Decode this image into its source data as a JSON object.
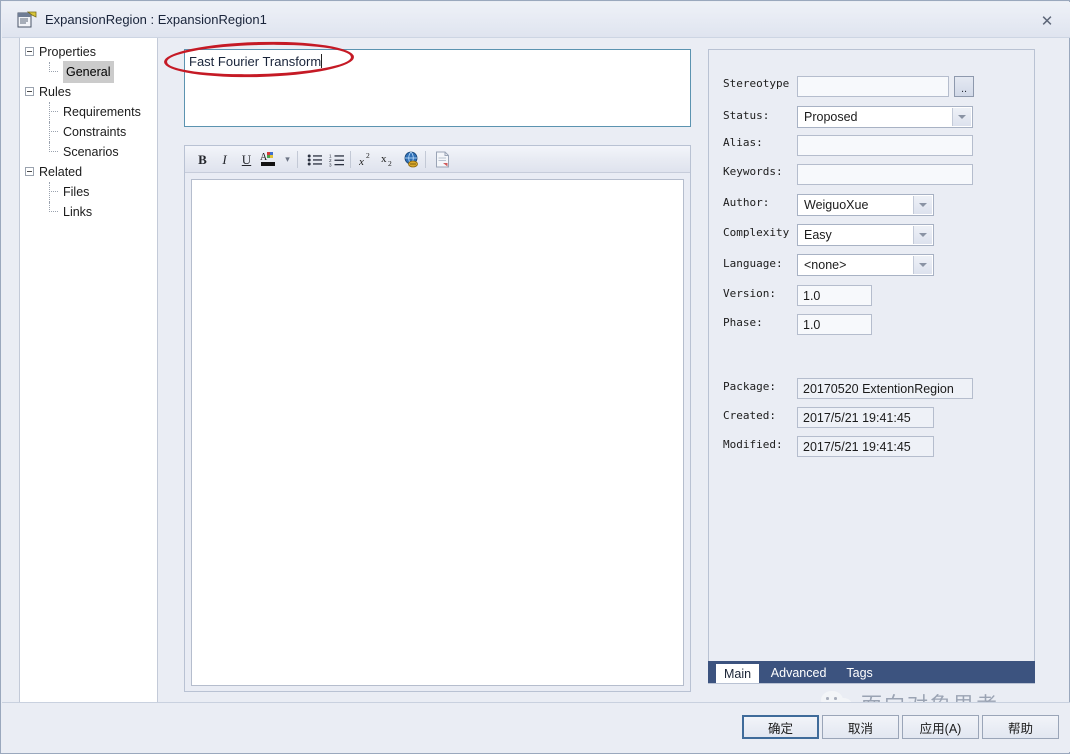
{
  "window": {
    "title": "ExpansionRegion : ExpansionRegion1",
    "icon": "properties-document-icon",
    "close_label": "✕"
  },
  "tree": {
    "nodes": [
      {
        "label": "Properties",
        "level": 0,
        "expanded": true,
        "selected": false
      },
      {
        "label": "General",
        "level": 1,
        "expanded": false,
        "selected": true
      },
      {
        "label": "Rules",
        "level": 0,
        "expanded": true,
        "selected": false
      },
      {
        "label": "Requirements",
        "level": 1,
        "expanded": false,
        "selected": false
      },
      {
        "label": "Constraints",
        "level": 1,
        "expanded": false,
        "selected": false
      },
      {
        "label": "Scenarios",
        "level": 1,
        "expanded": false,
        "selected": false
      },
      {
        "label": "Related",
        "level": 0,
        "expanded": true,
        "selected": false
      },
      {
        "label": "Files",
        "level": 1,
        "expanded": false,
        "selected": false
      },
      {
        "label": "Links",
        "level": 1,
        "expanded": false,
        "selected": false
      }
    ]
  },
  "name_field": {
    "value": "Fast Fourier Transform",
    "placeholder": "",
    "highlight_color": "#c51a25",
    "border_color": "#5b93b0"
  },
  "notes": {
    "value": "",
    "placeholder": "",
    "toolbar": [
      {
        "name": "bold-icon",
        "glyph": "B"
      },
      {
        "name": "italic-icon",
        "glyph": "I"
      },
      {
        "name": "underline-icon",
        "glyph": "U"
      },
      {
        "name": "font-color-icon",
        "glyph": "A"
      },
      {
        "name": "chevron-down-icon",
        "glyph": "▾"
      },
      {
        "name": "bulleted-list-icon",
        "glyph": "•≡"
      },
      {
        "name": "numbered-list-icon",
        "glyph": "1≡"
      },
      {
        "name": "superscript-icon",
        "glyph": "x²"
      },
      {
        "name": "subscript-icon",
        "glyph": "x₂"
      },
      {
        "name": "hyperlink-globe-icon",
        "glyph": "ἱ0"
      },
      {
        "name": "insert-document-icon",
        "glyph": "὜b"
      }
    ]
  },
  "properties": {
    "fields": [
      {
        "name": "stereotype",
        "label": "Stereotype",
        "value": "",
        "kind": "text-with-browse",
        "browse_label": ".."
      },
      {
        "name": "status",
        "label": "Status:",
        "value": "Proposed",
        "kind": "combo"
      },
      {
        "name": "alias",
        "label": "Alias:",
        "value": "",
        "kind": "text"
      },
      {
        "name": "keywords",
        "label": "Keywords:",
        "value": "",
        "kind": "text"
      },
      {
        "name": "author",
        "label": "Author:",
        "value": "WeiguoXue",
        "kind": "combo"
      },
      {
        "name": "complexity",
        "label": "Complexity",
        "value": "Easy",
        "kind": "combo"
      },
      {
        "name": "language",
        "label": "Language:",
        "value": "<none>",
        "kind": "combo"
      },
      {
        "name": "version",
        "label": "Version:",
        "value": "1.0",
        "kind": "text-small"
      },
      {
        "name": "phase",
        "label": "Phase:",
        "value": "1.0",
        "kind": "text-small"
      },
      {
        "name": "package",
        "label": "Package:",
        "value": "20170520 ExtentionRegion",
        "kind": "readonly"
      },
      {
        "name": "created",
        "label": "Created:",
        "value": "2017/5/21 19:41:45",
        "kind": "readonly"
      },
      {
        "name": "modified",
        "label": "Modified:",
        "value": "2017/5/21 19:41:45",
        "kind": "readonly"
      }
    ]
  },
  "tabs": [
    {
      "label": "Main",
      "active": true
    },
    {
      "label": "Advanced",
      "active": false
    },
    {
      "label": "Tags",
      "active": false
    }
  ],
  "footer": {
    "buttons": [
      {
        "name": "ok-button",
        "label": "确定",
        "primary": true
      },
      {
        "name": "cancel-button",
        "label": "取消",
        "primary": false
      },
      {
        "name": "apply-button",
        "label": "应用(A)",
        "primary": false
      },
      {
        "name": "help-button",
        "label": "帮助",
        "primary": false
      }
    ]
  },
  "watermark": {
    "text": "面向对象思考",
    "icon": "wechat-icon"
  }
}
